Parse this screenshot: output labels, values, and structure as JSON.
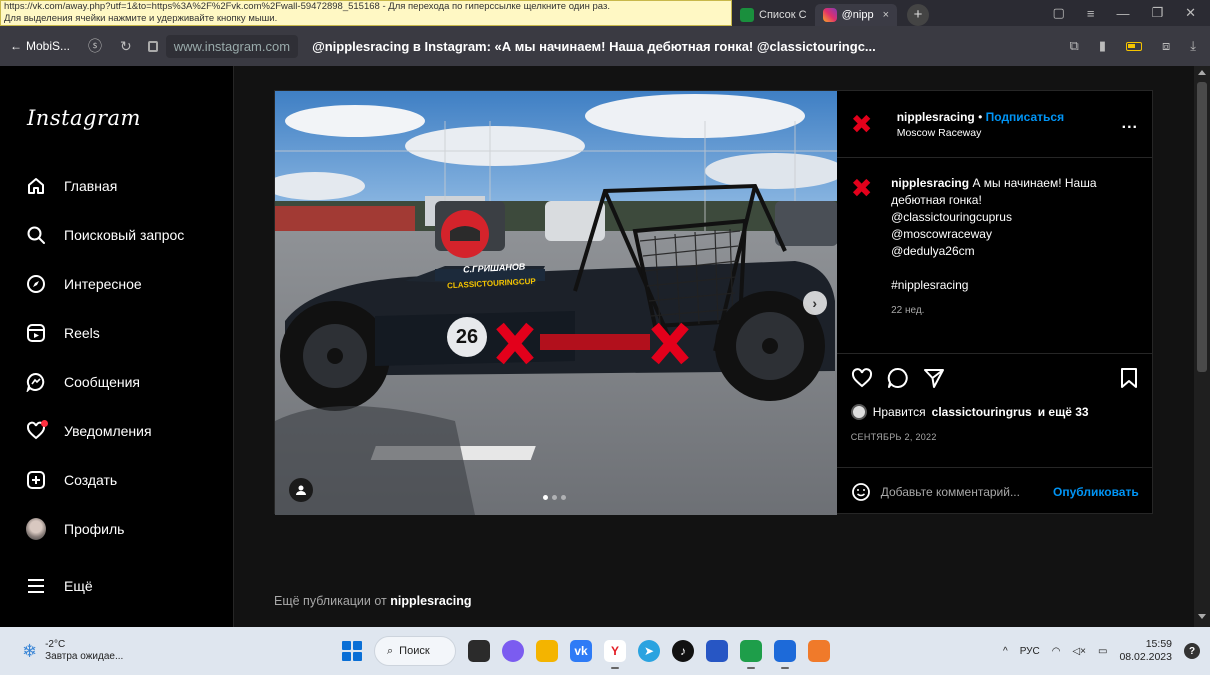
{
  "tooltip": {
    "line1": "https://vk.com/away.php?utf=1&to=https%3A%2F%2Fvk.com%2Fwall-59472898_515168 - Для перехода по гиперссылке щелкните один раз.",
    "line2": "Для выделения ячейки нажмите и удерживайте кнопку мыши."
  },
  "browser": {
    "tabs": [
      {
        "label": "Список С",
        "icon": "sheets-icon",
        "color": "#1a8f3d"
      },
      {
        "label": "@nipp",
        "icon": "instagram-icon",
        "color": "#e1306c",
        "close": "×"
      }
    ],
    "new_tab": "+",
    "back_label": "MobiS...",
    "url": "www.instagram.com",
    "page_title": "@nipplesracing в Instagram: «А мы начинаем! Наша дебютная гонка! @classictouringc..."
  },
  "sidebar": {
    "logo": "Instagram",
    "items": [
      {
        "label": "Главная",
        "icon": "home-icon"
      },
      {
        "label": "Поисковый запрос",
        "icon": "search-icon"
      },
      {
        "label": "Интересное",
        "icon": "compass-icon"
      },
      {
        "label": "Reels",
        "icon": "reels-icon"
      },
      {
        "label": "Сообщения",
        "icon": "messenger-icon"
      },
      {
        "label": "Уведомления",
        "icon": "heart-icon"
      },
      {
        "label": "Создать",
        "icon": "plus-square-icon"
      },
      {
        "label": "Профиль",
        "icon": "avatar"
      },
      {
        "label": "Ещё",
        "icon": "menu-icon"
      }
    ]
  },
  "post": {
    "username": "nipplesracing",
    "separator": "•",
    "follow_label": "Подписаться",
    "location": "Moscow Raceway",
    "more": "...",
    "caption_user": "nipplesracing",
    "caption_text": "А мы начинаем! Наша дебютная гонка!",
    "mentions": [
      "@classictouringcuprus",
      "@moscowraceway",
      "@dedulya26cm"
    ],
    "hashtag": "#nipplesracing",
    "caption_age": "22 нед.",
    "likes_prefix": "Нравится",
    "likes_user": "classictouringrus",
    "likes_suffix": "и ещё 33",
    "date": "СЕНТЯБРЬ 2, 2022",
    "comment_placeholder": "Добавьте комментарий...",
    "publish_label": "Опубликовать",
    "car_number": "26",
    "car_driver": "С.ГРИШАНОВ",
    "car_sponsor": "CLASSICTOURINGCUP",
    "slide_index": 1,
    "slide_count": 3
  },
  "more_from": {
    "prefix": "Ещё публикации от",
    "user": "nipplesracing"
  },
  "taskbar": {
    "temperature": "-2°C",
    "weather_text": "Завтра ожидае...",
    "search_label": "Поиск",
    "lang": "РУС",
    "time": "15:59",
    "date": "08.02.2023"
  },
  "colors": {
    "accent_blue": "#0095f6",
    "brand_red": "#e3001b"
  }
}
